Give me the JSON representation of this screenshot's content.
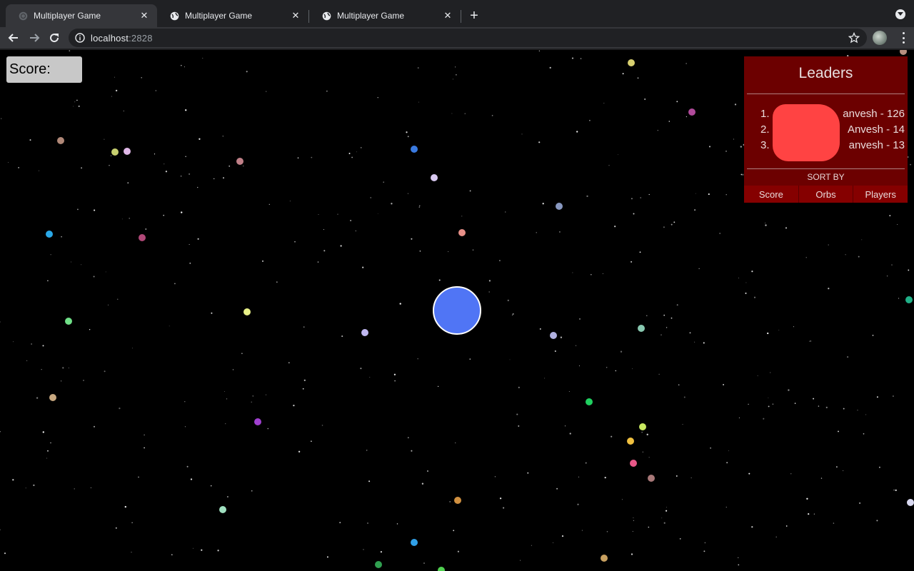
{
  "browser": {
    "tabs": [
      {
        "title": "Multiplayer Game",
        "active": true
      },
      {
        "title": "Multiplayer Game",
        "active": false
      },
      {
        "title": "Multiplayer Game",
        "active": false
      }
    ],
    "address": {
      "host": "localhost",
      "port": ":2828"
    },
    "icons": {
      "back": "arrow-left-icon",
      "forward": "arrow-right-icon",
      "reload": "reload-icon",
      "info": "info-icon",
      "bookmark": "star-icon",
      "menu": "kebab-menu-icon",
      "new_tab": "plus-icon"
    }
  },
  "game": {
    "score_label": "Score:",
    "player_color": "#5075f5",
    "leaderboard": {
      "title": "Leaders",
      "entries": [
        {
          "rank": "1.",
          "name": "anvesh",
          "score": "126",
          "text": "anvesh - 126"
        },
        {
          "rank": "2.",
          "name": "Anvesh",
          "score": "14",
          "text": "Anvesh - 14"
        },
        {
          "rank": "3.",
          "name": "anvesh",
          "score": "13",
          "text": "anvesh - 13"
        }
      ],
      "sort_by_label": "SORT BY",
      "sort_buttons": [
        "Score",
        "Orbs",
        "Players"
      ]
    },
    "colors": {
      "background": "#000000",
      "leaderboard_bg": "#6c0000",
      "redaction": "#ff4343",
      "score_box": "#c8c8c8"
    }
  }
}
